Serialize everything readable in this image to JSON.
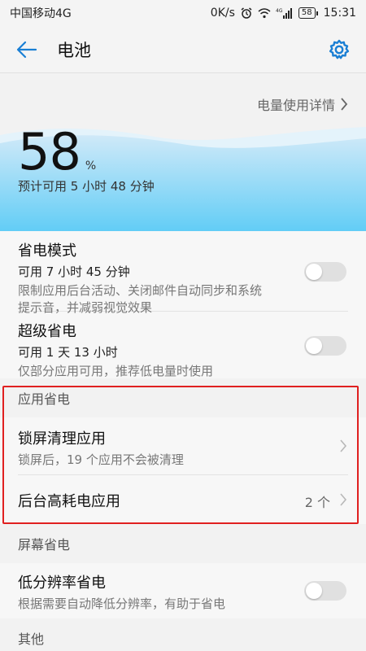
{
  "status_bar": {
    "carrier": "中国移动4G",
    "speed": "0K/s",
    "network_badge": "4G",
    "battery_level": "58",
    "time": "15:31"
  },
  "header": {
    "title": "电池"
  },
  "battery": {
    "usage_details_label": "电量使用详情",
    "percent": "58",
    "percent_sign": "%",
    "estimate": "预计可用 5 小时 48 分钟"
  },
  "power_saving_mode": {
    "title": "省电模式",
    "available": "可用 7 小时 45 分钟",
    "description_line1": "限制应用后台活动、关闭邮件自动同步和系统",
    "description_line2": "提示音，并减弱视觉效果",
    "enabled": false
  },
  "ultra_power_saving": {
    "title": "超级省电",
    "available": "可用 1 天 13 小时",
    "description": "仅部分应用可用，推荐低电量时使用",
    "enabled": false
  },
  "app_power_saving": {
    "section_title": "应用省电",
    "lock_screen_cleanup": {
      "title": "锁屏清理应用",
      "description": "锁屏后，19 个应用不会被清理"
    },
    "background_high_power": {
      "title": "后台高耗电应用",
      "count": "2 个"
    }
  },
  "screen_power_saving": {
    "section_title": "屏幕省电",
    "low_resolution": {
      "title": "低分辨率省电",
      "description": "根据需要自动降低分辨率，有助于省电",
      "enabled": false
    }
  },
  "other": {
    "section_title": "其他"
  },
  "colors": {
    "accent": "#1a7fd4",
    "wave_light": "#d8eefa",
    "wave_dark": "#6fd0f5",
    "highlight": "#e02020"
  }
}
